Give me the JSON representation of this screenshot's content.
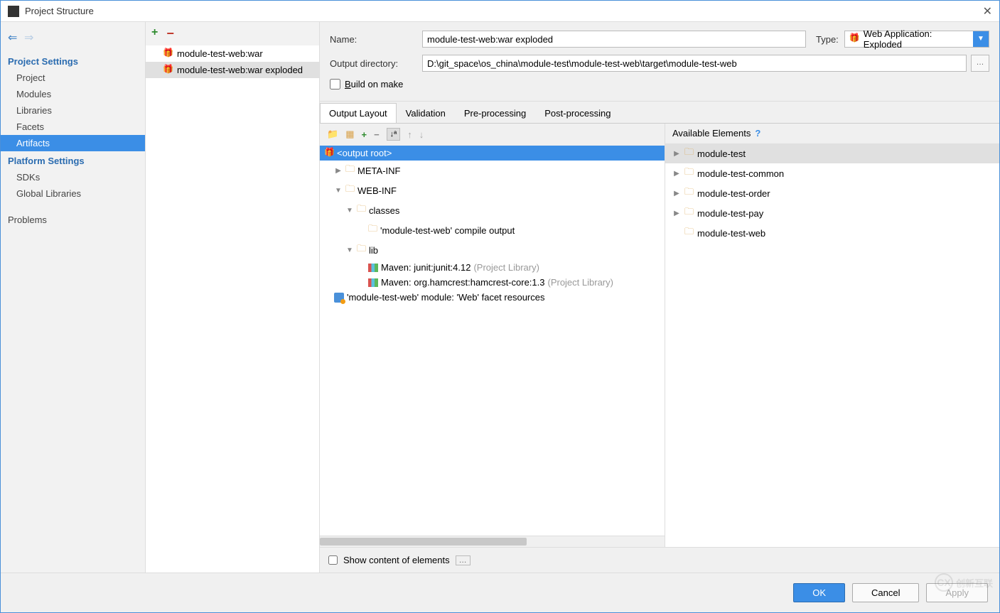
{
  "window": {
    "title": "Project Structure"
  },
  "sidebar": {
    "section1": "Project Settings",
    "items1": [
      "Project",
      "Modules",
      "Libraries",
      "Facets",
      "Artifacts"
    ],
    "section2": "Platform Settings",
    "items2": [
      "SDKs",
      "Global Libraries"
    ],
    "problems": "Problems"
  },
  "artifacts": {
    "items": [
      "module-test-web:war",
      "module-test-web:war exploded"
    ]
  },
  "form": {
    "name_label": "Name:",
    "name_value": "module-test-web:war exploded",
    "type_label": "Type:",
    "type_value": "Web Application: Exploded",
    "output_label": "Output directory:",
    "output_value": "D:\\git_space\\os_china\\module-test\\module-test-web\\target\\module-test-web",
    "build_label": "Build on make"
  },
  "tabs": [
    "Output Layout",
    "Validation",
    "Pre-processing",
    "Post-processing"
  ],
  "layout": {
    "root": "<output root>",
    "meta": "META-INF",
    "webinf": "WEB-INF",
    "classes": "classes",
    "compile": "'module-test-web' compile output",
    "lib": "lib",
    "junit": "Maven: junit:junit:4.12",
    "junit_suffix": "(Project Library)",
    "hamcrest": "Maven: org.hamcrest:hamcrest-core:1.3",
    "hamcrest_suffix": "(Project Library)",
    "facet": "'module-test-web' module: 'Web' facet resources"
  },
  "available": {
    "header": "Available Elements",
    "items": [
      "module-test",
      "module-test-common",
      "module-test-order",
      "module-test-pay",
      "module-test-web"
    ]
  },
  "bottom": {
    "show_content": "Show content of elements"
  },
  "buttons": {
    "ok": "OK",
    "cancel": "Cancel",
    "apply": "Apply"
  },
  "watermark": "创新互联"
}
